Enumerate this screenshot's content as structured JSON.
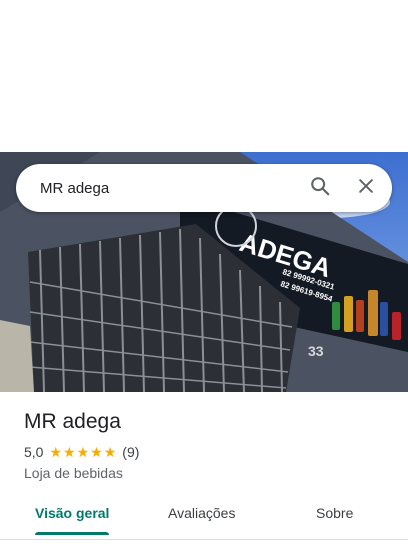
{
  "search": {
    "query": "MR adega"
  },
  "photo": {
    "sign_text": "ADEGA",
    "phone_1": "82 99992-0321",
    "phone_2": "82 99619-8954",
    "house_number": "33"
  },
  "place": {
    "name": "MR adega",
    "rating": "5,0",
    "stars": 5,
    "review_count": "(9)",
    "category": "Loja de bebidas"
  },
  "tabs": [
    {
      "label": "Visão geral",
      "active": true
    },
    {
      "label": "Avaliações",
      "active": false
    },
    {
      "label": "Sobre",
      "active": false
    }
  ],
  "icons": {
    "search": "search-icon",
    "close": "close-icon",
    "star": "star-icon"
  },
  "colors": {
    "accent": "#00796b",
    "star": "#f9ab00"
  }
}
